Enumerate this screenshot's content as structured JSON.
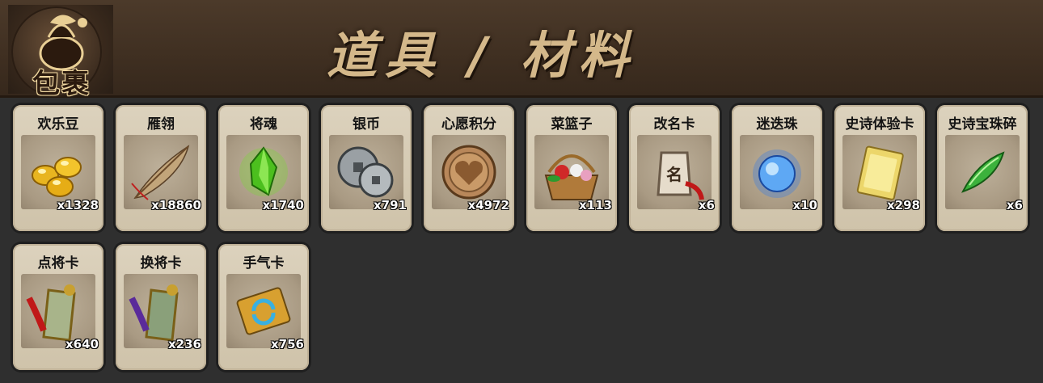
{
  "header": {
    "bag_label": "包裹",
    "title": "道具 / 材料"
  },
  "items": [
    {
      "name": "欢乐豆",
      "count": "x1328",
      "icon": "golden-beans-icon"
    },
    {
      "name": "雁翎",
      "count": "x18860",
      "icon": "feather-icon"
    },
    {
      "name": "将魂",
      "count": "x1740",
      "icon": "green-crystal-icon"
    },
    {
      "name": "银币",
      "count": "x791",
      "icon": "silver-coin-icon"
    },
    {
      "name": "心愿积分",
      "count": "x4972",
      "icon": "heart-coin-icon"
    },
    {
      "name": "菜篮子",
      "count": "x113",
      "icon": "flower-basket-icon"
    },
    {
      "name": "改名卡",
      "count": "x6",
      "icon": "rename-tag-icon"
    },
    {
      "name": "迷迭珠",
      "count": "x10",
      "icon": "blue-orb-icon"
    },
    {
      "name": "史诗体验卡",
      "count": "x298",
      "icon": "gold-card-icon"
    },
    {
      "name": "史诗宝珠碎",
      "count": "x6",
      "icon": "green-shard-icon"
    },
    {
      "name": "点将卡",
      "count": "x640",
      "icon": "general-tag-red-icon"
    },
    {
      "name": "换将卡",
      "count": "x236",
      "icon": "general-tag-purple-icon"
    },
    {
      "name": "手气卡",
      "count": "x756",
      "icon": "refresh-card-icon"
    }
  ]
}
